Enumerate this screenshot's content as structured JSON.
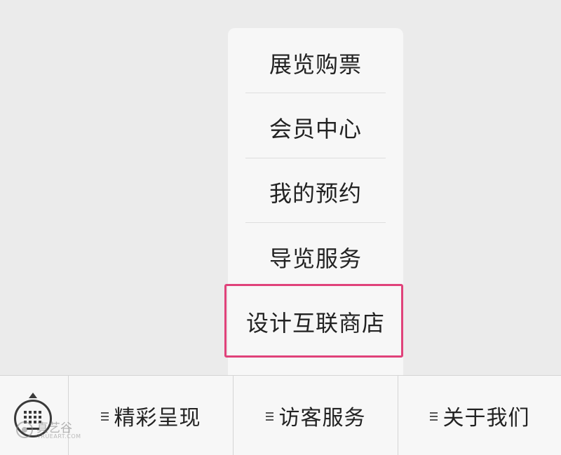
{
  "submenu": {
    "items": [
      {
        "label": "展览购票"
      },
      {
        "label": "会员中心"
      },
      {
        "label": "我的预约"
      },
      {
        "label": "导览服务"
      },
      {
        "label": "设计互联商店"
      }
    ],
    "highlighted_index": 4,
    "highlight_color": "#e0427a"
  },
  "bottom_bar": {
    "keyboard_icon": "keyboard-icon",
    "tabs": [
      {
        "label": "精彩呈现",
        "icon": "menu-lines-icon"
      },
      {
        "label": "访客服务",
        "icon": "menu-lines-icon"
      },
      {
        "label": "关于我们",
        "icon": "menu-lines-icon"
      }
    ]
  },
  "watermark": {
    "title": "真艺谷",
    "subtitle": "TRUEART.COM"
  }
}
